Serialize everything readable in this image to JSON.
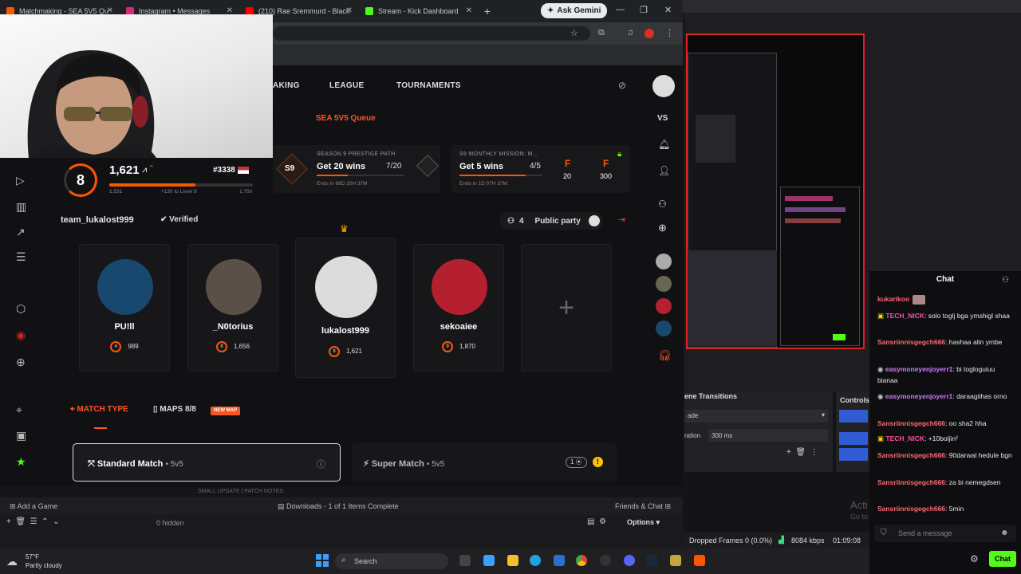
{
  "browser": {
    "tabs": [
      {
        "title": "Matchmaking - SEA 5V5 Qu",
        "color": "#ff5500"
      },
      {
        "title": "Instagram • Messages",
        "color": "#d62976"
      },
      {
        "title": "(210) Rae Sremmurd - Black",
        "color": "#ff0000"
      },
      {
        "title": "Stream - Kick Dashboard",
        "color": "#53fc18"
      }
    ],
    "gemini_label": "Ask Gemini"
  },
  "nav": {
    "matchmaking": "AKING",
    "league": "LEAGUE",
    "tournaments": "TOURNAMENTS",
    "vs": "VS"
  },
  "queue_label": "SEA 5V5 Queue",
  "prestige": {
    "title": "SEASON 9 PRESTIGE PATH",
    "badge": "S9",
    "goal": "Get 20 wins",
    "progress": "7/20",
    "ends": "Ends in 66D 20H 37M",
    "fraction": 0.35
  },
  "monthly": {
    "title": "S9 MONTHLY MISSION: M...",
    "goal": "Get 5 wins",
    "progress": "4/5",
    "ends": "Ends in 1D 07H 37M",
    "fraction": 0.8,
    "reward1": "20",
    "reward2": "300",
    "reward_icon": "F"
  },
  "profile": {
    "level": "8",
    "elo": "1,621",
    "rank": "#3338",
    "elo_min": "1,531",
    "elo_hint": "+130 to Level 9",
    "elo_max": "1,750",
    "fraction": 0.6
  },
  "party": {
    "name": "team_lukalost999",
    "verified": "Verified",
    "count": "4",
    "label": "Public party"
  },
  "members": [
    {
      "name": "PU!ll",
      "level": "4",
      "elo": "989",
      "avatar": "#18486e"
    },
    {
      "name": "_N0torius",
      "level": "8",
      "elo": "1,656",
      "avatar": "#5a5048"
    },
    {
      "name": "lukalost999",
      "level": "8",
      "elo": "1,621",
      "avatar": "#dcdcdc"
    },
    {
      "name": "sekoaiee",
      "level": "9",
      "elo": "1,870",
      "avatar": "#b52030"
    }
  ],
  "plus_icon": "+",
  "match": {
    "type_label": "MATCH TYPE",
    "maps_label": "MAPS 8/8",
    "new_map": "NEW MAP",
    "standard": "Standard Match",
    "standard_sub": "• 5v5",
    "super": "Super Match",
    "super_sub": "• 5v5",
    "super_count": "1"
  },
  "status_text": "SMALL UPDATE | PATCH NOTES",
  "downloads": {
    "add_game": "Add a Game",
    "status": "Downloads - 1 of 1 Items Complete",
    "friends": "Friends & Chat"
  },
  "obs": {
    "hidden": "0 hidden",
    "options": "Options",
    "transitions": "ene Transitions",
    "controls": "Controls",
    "fade": "ade",
    "duration_label": "ration",
    "duration": "300 ms",
    "dropped": "Dropped Frames 0 (0.0%)",
    "kbps": "8084 kbps",
    "time": "01:09:08"
  },
  "chat": {
    "header": "Chat",
    "placeholder": "Send a message",
    "button": "Chat",
    "messages": [
      {
        "user": "kukarikoo",
        "text": "",
        "color": "#ff6b6b"
      },
      {
        "user": "TECH_NICK",
        "text": ": solo toglj bga ymshigl shaa",
        "color": "#ff4fa3"
      },
      {
        "user": "Sansriinnisgegch666",
        "text": ": hashaa alin ymbe",
        "color": "#ff6b6b"
      },
      {
        "user": "easymoneyenjoyerr1",
        "text": ": bi togloguiuu bianaa",
        "color": "#cf7bff"
      },
      {
        "user": "easymoneyenjoyerr1",
        "text": ": daraagiihas orno",
        "color": "#cf7bff"
      },
      {
        "user": "Sansriinnisgegch666",
        "text": ": oo sha2 hha",
        "color": "#ff6b6b"
      },
      {
        "user": "TECH_NICK",
        "text": ": +10boljin²",
        "color": "#ff4fa3"
      },
      {
        "user": "Sansriinnisgegch666",
        "text": ": 90darwal hedule bgn",
        "color": "#ff6b6b"
      },
      {
        "user": "Sansriinnisgegch666",
        "text": ": za bi nemegdsen",
        "color": "#ff6b6b"
      },
      {
        "user": "Sansriinnisgegch666",
        "text": ": 5min",
        "color": "#ff6b6b"
      }
    ]
  },
  "taskbar": {
    "temp": "57°F",
    "weather": "Partly cloudy",
    "search": "Search"
  },
  "overlay_text": "Acti",
  "overlay_text2": "Go to"
}
